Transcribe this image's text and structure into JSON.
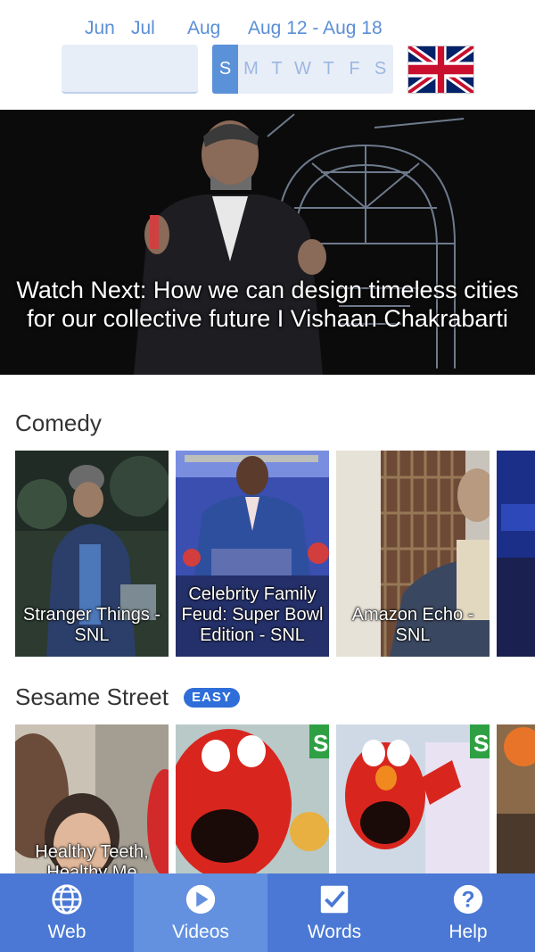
{
  "header": {
    "months": [
      "Jun",
      "Jul",
      "Aug"
    ],
    "week_range": "Aug 12 - Aug 18",
    "days": [
      "S",
      "M",
      "T",
      "W",
      "T",
      "F",
      "S"
    ],
    "selected_day_index": 0,
    "language_flag": "uk-flag-icon"
  },
  "hero": {
    "title": "Watch Next: How we can design timeless cities for our collective future I Vishaan Chakrabarti"
  },
  "sections": {
    "comedy": {
      "title": "Comedy",
      "items": [
        {
          "caption": "Stranger Things - SNL"
        },
        {
          "caption": "Celebrity Family Feud: Super Bowl Edition - SNL"
        },
        {
          "caption": "Amazon Echo - SNL"
        },
        {
          "caption": ""
        }
      ]
    },
    "sesame": {
      "title": "Sesame Street",
      "badge": "EASY",
      "items": [
        {
          "caption": "Healthy Teeth, Healthy Me"
        },
        {
          "caption": ""
        },
        {
          "caption": ""
        },
        {
          "caption": ""
        }
      ]
    }
  },
  "nav": {
    "items": [
      {
        "label": "Web",
        "icon": "globe-icon"
      },
      {
        "label": "Videos",
        "icon": "play-icon"
      },
      {
        "label": "Words",
        "icon": "checkbox-icon"
      },
      {
        "label": "Help",
        "icon": "help-icon"
      }
    ],
    "active_index": 1
  },
  "colors": {
    "accent": "#4a78d4",
    "nav_active": "#6391e0",
    "day_selected": "#5b91d8",
    "month_text": "#5b8fd6",
    "badge": "#2f6ed8"
  }
}
